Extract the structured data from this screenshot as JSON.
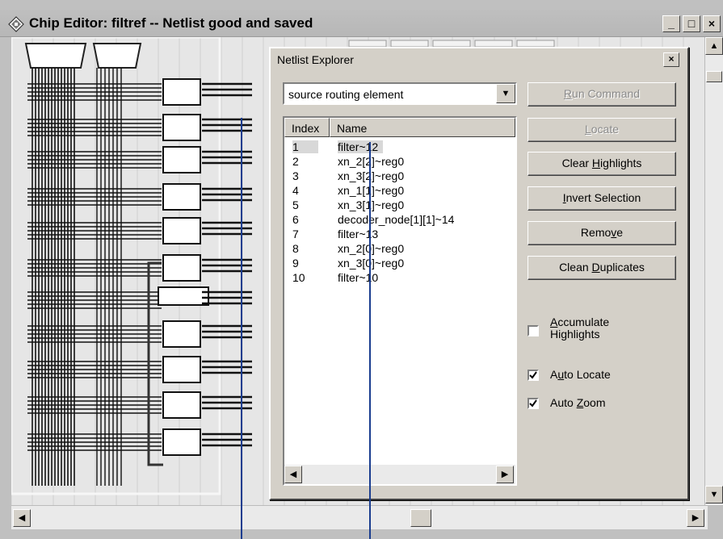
{
  "app": {
    "title": "Chip Editor: filtref  -- Netlist good and saved",
    "controls": {
      "minimize": "_",
      "maximize": "□",
      "close": "×"
    }
  },
  "dialog": {
    "title": "Netlist Explorer",
    "close": "×",
    "combo": {
      "value": "source routing element"
    },
    "list": {
      "headers": {
        "index": "Index",
        "name": "Name"
      },
      "rows": [
        {
          "index": "1",
          "name": "filter~12",
          "selected": true
        },
        {
          "index": "2",
          "name": "xn_2[2]~reg0"
        },
        {
          "index": "3",
          "name": "xn_3[2]~reg0"
        },
        {
          "index": "4",
          "name": "xn_1[1]~reg0"
        },
        {
          "index": "5",
          "name": "xn_3[1]~reg0"
        },
        {
          "index": "6",
          "name": "decoder_node[1][1]~14"
        },
        {
          "index": "7",
          "name": "filter~13"
        },
        {
          "index": "8",
          "name": "xn_2[0]~reg0"
        },
        {
          "index": "9",
          "name": "xn_3[0]~reg0"
        },
        {
          "index": "10",
          "name": "filter~10"
        }
      ]
    },
    "buttons": {
      "run_command": {
        "pre": "",
        "key": "R",
        "post": "un Command"
      },
      "locate": {
        "pre": "",
        "key": "L",
        "post": "ocate"
      },
      "clear_highlights": {
        "pre": "Clear ",
        "key": "H",
        "post": "ighlights"
      },
      "invert_selection": {
        "pre": "",
        "key": "I",
        "post": "nvert Selection"
      },
      "remove": {
        "pre": "Remo",
        "key": "v",
        "post": "e"
      },
      "clean_duplicates": {
        "pre": "Clean ",
        "key": "D",
        "post": "uplicates"
      }
    },
    "checkboxes": {
      "accumulate": {
        "key": "A",
        "line1_rest": "ccumulate",
        "line2": "Highlights",
        "checked": false
      },
      "auto_locate": {
        "pre": "A",
        "key": "u",
        "post": "to Locate",
        "checked": true
      },
      "auto_zoom": {
        "pre": "Auto ",
        "key": "Z",
        "post": "oom",
        "checked": true
      }
    }
  },
  "icons": {
    "app": "chip-icon",
    "combo_arrow": "dropdown-arrow-icon",
    "scroll_left": "arrow-left-icon",
    "scroll_right": "arrow-right-icon",
    "scroll_up": "arrow-up-icon",
    "scroll_down": "arrow-down-icon"
  },
  "colors": {
    "window_bg": "#d4d0c8",
    "selection_bg": "#d8d8d8",
    "disabled_text": "#8a8a8a",
    "cursor_line": "#1a3d8f"
  }
}
